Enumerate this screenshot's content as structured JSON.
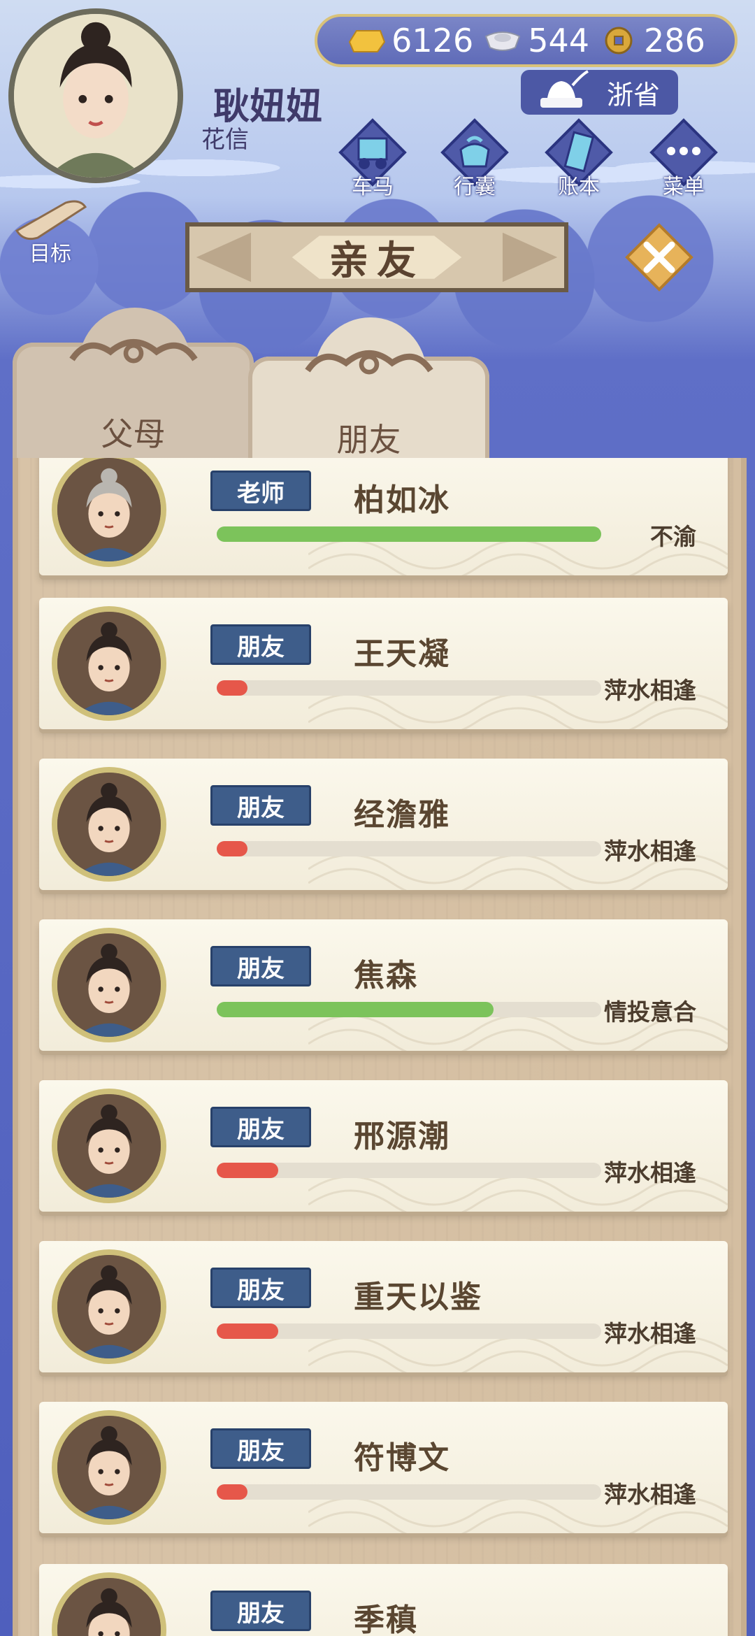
{
  "player": {
    "name": "耿妞妞",
    "subtitle": "花信"
  },
  "resources": [
    {
      "icon": "gold-ingot-icon",
      "value": "6126"
    },
    {
      "icon": "silver-ingot-icon",
      "value": "544"
    },
    {
      "icon": "copper-coin-icon",
      "value": "286"
    }
  ],
  "province": {
    "label": "浙省"
  },
  "menu": {
    "carriage": "车马",
    "bag": "行囊",
    "ledger": "账本",
    "menu": "菜单",
    "goal": "目标"
  },
  "title": "亲友",
  "tabs": {
    "parents": "父母",
    "friends": "朋友"
  },
  "colors": {
    "green": "#7cc35b",
    "red": "#e6574a",
    "tag_blue": "#3e5d8a"
  },
  "friends": [
    {
      "tag": "老师",
      "name": "柏如冰",
      "status": "不渝",
      "level": 1.0,
      "bar_color": "#7cc35b"
    },
    {
      "tag": "朋友",
      "name": "王天凝",
      "status": "萍水相逢",
      "level": 0.08,
      "bar_color": "#e6574a"
    },
    {
      "tag": "朋友",
      "name": "经澹雅",
      "status": "萍水相逢",
      "level": 0.08,
      "bar_color": "#e6574a"
    },
    {
      "tag": "朋友",
      "name": "焦森",
      "status": "情投意合",
      "level": 0.72,
      "bar_color": "#7cc35b"
    },
    {
      "tag": "朋友",
      "name": "邢源潮",
      "status": "萍水相逢",
      "level": 0.16,
      "bar_color": "#e6574a"
    },
    {
      "tag": "朋友",
      "name": "重天以鉴",
      "status": "萍水相逢",
      "level": 0.16,
      "bar_color": "#e6574a"
    },
    {
      "tag": "朋友",
      "name": "符博文",
      "status": "萍水相逢",
      "level": 0.08,
      "bar_color": "#e6574a"
    },
    {
      "tag": "朋友",
      "name": "季稹",
      "status": "",
      "level": 0,
      "bar_color": "#e6574a"
    }
  ]
}
